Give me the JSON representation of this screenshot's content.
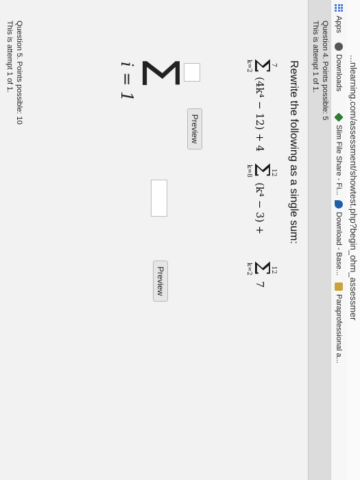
{
  "browser": {
    "url": "...nlearning.com/assessment/showtest.php?begin_ohm_assessmer",
    "bookmarks": [
      {
        "label": "Apps",
        "icon": "apps-grid-icon"
      },
      {
        "label": "Downloads",
        "icon": "downloads-icon"
      },
      {
        "label": "Slim File Share - Fi...",
        "icon": "fileshare-icon"
      },
      {
        "label": "Download - Base...",
        "icon": "download-icon"
      },
      {
        "label": "Paraprofessional a...",
        "icon": "bookmark-icon"
      }
    ]
  },
  "question4": {
    "title": "Question 4. Points possible: 5",
    "attempt": "This is attempt 1 of 1.",
    "prompt": "Rewrite the following as a single sum:",
    "sum1": {
      "upper": "7",
      "lower": "k=2",
      "term": "(4k⁴ − 12) + 4"
    },
    "sum2": {
      "upper": "12",
      "lower": "k=8",
      "term": "(k⁴ − 3) +"
    },
    "sum3": {
      "upper": "12",
      "lower": "k=2",
      "term": "7"
    },
    "preview_label_1": "Preview",
    "preview_label_2": "Preview",
    "answer_sigma": "Σ",
    "answer_index": "i = 1"
  },
  "question5": {
    "title": "Question 5. Points possible: 10",
    "attempt": "This is attempt 1 of 1."
  }
}
